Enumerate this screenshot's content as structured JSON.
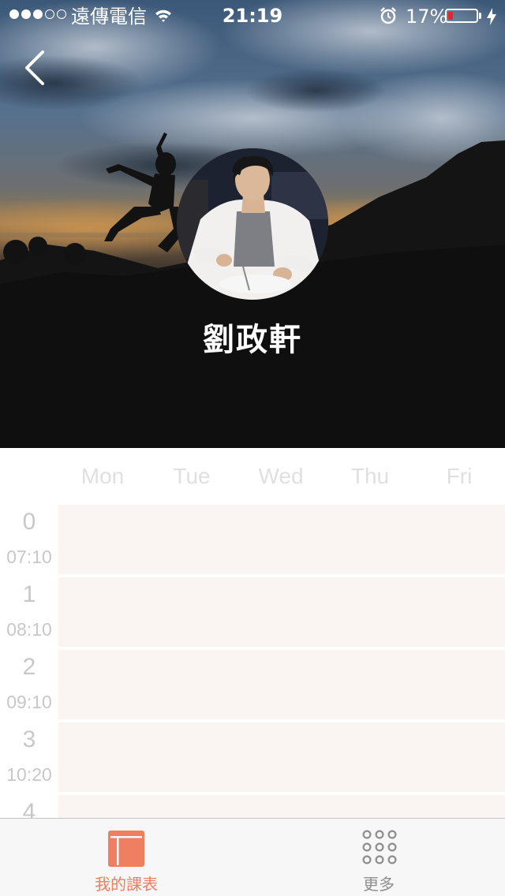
{
  "status_bar": {
    "carrier": "遠傳電信",
    "time": "21:19",
    "battery_percent": "17%",
    "battery_level": 0.17,
    "signal_bars_filled": 3,
    "signal_bars_total": 5
  },
  "profile": {
    "name": "劉政軒"
  },
  "timetable": {
    "days": [
      "Mon",
      "Tue",
      "Wed",
      "Thu",
      "Fri"
    ],
    "periods": [
      {
        "number": "0",
        "time": "07:10"
      },
      {
        "number": "1",
        "time": "08:10"
      },
      {
        "number": "2",
        "time": "09:10"
      },
      {
        "number": "3",
        "time": "10:20"
      },
      {
        "number": "4",
        "time": ""
      }
    ]
  },
  "tab_bar": {
    "tabs": [
      {
        "label": "我的課表",
        "icon": "timetable-icon",
        "active": true
      },
      {
        "label": "更多",
        "icon": "grid-dots-icon",
        "active": false
      }
    ]
  },
  "colors": {
    "accent": "#f07f62",
    "cell_bg": "#faf5f2",
    "battery_low": "#e6262b",
    "inactive": "#8d8d8d"
  }
}
